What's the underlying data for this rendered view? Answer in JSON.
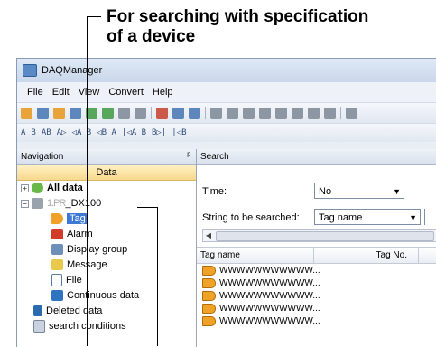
{
  "callout": {
    "line1": "For searching with specification",
    "line2": "of a device"
  },
  "window": {
    "title": "DAQManager"
  },
  "menu": [
    "File",
    "Edit",
    "View",
    "Convert",
    "Help"
  ],
  "navigation": {
    "header": "Navigation",
    "pin_glyph": "ᵖ",
    "data_header": "Data",
    "tree": {
      "all_data": "All data",
      "device": "_DX100",
      "device_prefix_redacted": "1.PR  ",
      "children": [
        "Tag",
        "Alarm",
        "Display group",
        "Message",
        "File",
        "Continuous data"
      ],
      "deleted": "Deleted data",
      "search_conditions": "search conditions"
    }
  },
  "search": {
    "header": "Search",
    "time_label": "Time:",
    "time_value": "No",
    "string_label": "String to be searched:",
    "string_value": "Tag name",
    "columns": [
      "Tag name",
      "Tag No."
    ],
    "rows": [
      "WWWWWWWWWWW...",
      "WWWWWWWWWWW...",
      "WWWWWWWWWWW...",
      "WWWWWWWWWWW...",
      "WWWWWWWWWWW..."
    ]
  },
  "colors": {
    "selection": "#3d79d4",
    "data_header": "#f7d98d"
  }
}
